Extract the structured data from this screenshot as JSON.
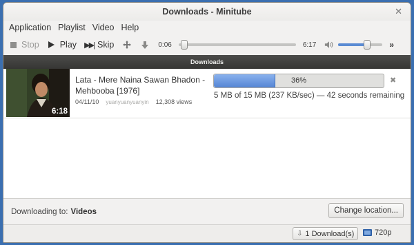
{
  "window": {
    "title": "Downloads - Minitube"
  },
  "menubar": {
    "items": [
      {
        "label": "Application"
      },
      {
        "label": "Playlist"
      },
      {
        "label": "Video"
      },
      {
        "label": "Help"
      }
    ]
  },
  "toolbar": {
    "stop_label": "Stop",
    "play_label": "Play",
    "skip_label": "Skip",
    "elapsed": "0:06",
    "total": "6:17",
    "seek_fraction": 0.02,
    "volume_fraction": 0.65,
    "overflow_label": "»",
    "icons": [
      "stop-icon",
      "play-icon",
      "skip-icon",
      "fullscreen-icon",
      "download-icon",
      "volume-icon"
    ]
  },
  "downloads": {
    "header": "Downloads",
    "items": [
      {
        "title": "Lata - Mere Naina Sawan Bhadon - Mehbooba [1976]",
        "duration": "6:18",
        "date": "04/11/10",
        "author": "yuanyuanyuanyin",
        "views": "12,308 views",
        "progress_percent": 36,
        "progress_label": "36%",
        "status": "5 MB of 15 MB (237 KB/sec) — 42 seconds remaining"
      }
    ]
  },
  "footer": {
    "downloading_to_label": "Downloading to:",
    "folder": "Videos",
    "change_location_label": "Change location..."
  },
  "statusbar": {
    "downloads_label": "1 Download(s)",
    "resolution": "720p"
  },
  "colors": {
    "accent": "#5585d4",
    "header_bg": "#3f3f3d",
    "desktop": "#3b6fb0"
  }
}
